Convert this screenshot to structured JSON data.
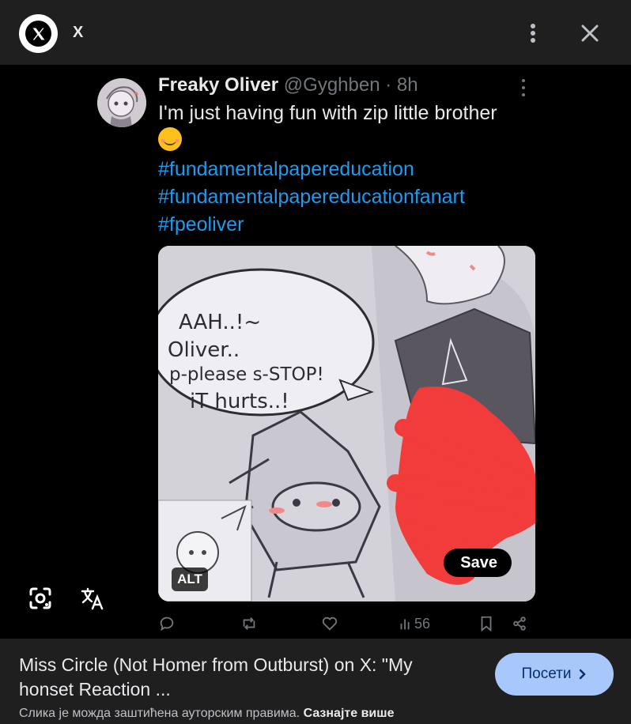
{
  "app": {
    "title": "X",
    "logo_letter": "X"
  },
  "tweet": {
    "display_name": "Freaky Oliver",
    "handle": "@Gyghben",
    "separator": " · ",
    "time": "8h",
    "text": "I'm just having fun with zip little brother",
    "emoji": "smiling-face-with-blush",
    "hashtags": [
      "#fundamentalpapereducation",
      "#fundamentalpapereducationfanart",
      "#fpeoliver"
    ],
    "media": {
      "bubble_lines": [
        "AAH..!~",
        "Oliver..",
        "p-please s-STOP!",
        "iT hurts..!"
      ],
      "alt_badge": "ALT",
      "save_label": "Save"
    },
    "actions": {
      "views": "56"
    }
  },
  "overlay": {
    "lens_icon": "google-lens-icon",
    "translate_icon": "translate-icon"
  },
  "result": {
    "title": "Miss Circle (Not Homer from Outburst) on X: \"My honset Reaction ...",
    "visit_label": "Посети",
    "copyright_notice": "Слика је можда заштићена ауторским правима.",
    "learn_more": "Сазнајте више"
  },
  "colors": {
    "link_blue": "#1d9bf0",
    "visit_bg": "#a8c7fa",
    "bar_bg": "#1f1f1f",
    "scribble_red": "#f23b3b"
  }
}
